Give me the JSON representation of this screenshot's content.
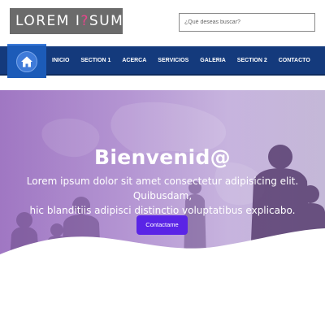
{
  "header": {
    "logo_part1": "LOREM I",
    "logo_q": "?",
    "logo_part2": "SUM",
    "search_placeholder": "¿Qué deseas buscar?"
  },
  "nav": {
    "home_icon": "home-icon",
    "items": [
      "INICIO",
      "SECTION 1",
      "ACERCA",
      "SERVICIOS",
      "GALERIA",
      "SECTION 2",
      "CONTACTO"
    ]
  },
  "hero": {
    "title": "Bienvenid@",
    "text_line1": "Lorem ipsum dolor sit amet consectetur adipisicing elit. Quibusdam,",
    "text_line2": "hic blanditiis adipisci distinctio voluptatibus explicabo.",
    "cta_label": "Contactame"
  },
  "colors": {
    "navbar": "#143a7c",
    "home_button": "#1c5bb8",
    "cta": "#5a24e6",
    "hero_purple": "#a27bc4",
    "logo_bg": "#6b6b6b",
    "logo_accent": "#e8458b"
  }
}
